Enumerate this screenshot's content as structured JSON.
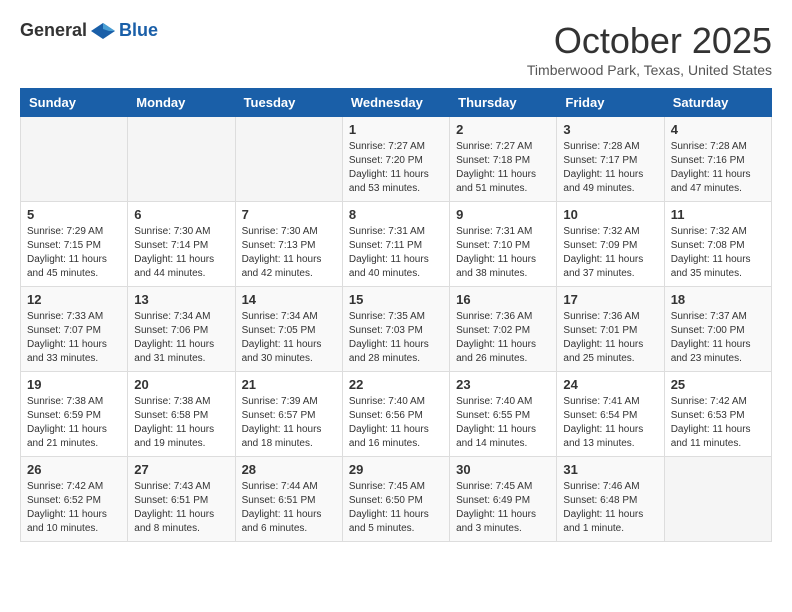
{
  "header": {
    "logo": {
      "general": "General",
      "blue": "Blue"
    },
    "title": "October 2025",
    "location": "Timberwood Park, Texas, United States"
  },
  "weekdays": [
    "Sunday",
    "Monday",
    "Tuesday",
    "Wednesday",
    "Thursday",
    "Friday",
    "Saturday"
  ],
  "weeks": [
    [
      {
        "day": "",
        "info": ""
      },
      {
        "day": "",
        "info": ""
      },
      {
        "day": "",
        "info": ""
      },
      {
        "day": "1",
        "info": "Sunrise: 7:27 AM\nSunset: 7:20 PM\nDaylight: 11 hours and 53 minutes."
      },
      {
        "day": "2",
        "info": "Sunrise: 7:27 AM\nSunset: 7:18 PM\nDaylight: 11 hours and 51 minutes."
      },
      {
        "day": "3",
        "info": "Sunrise: 7:28 AM\nSunset: 7:17 PM\nDaylight: 11 hours and 49 minutes."
      },
      {
        "day": "4",
        "info": "Sunrise: 7:28 AM\nSunset: 7:16 PM\nDaylight: 11 hours and 47 minutes."
      }
    ],
    [
      {
        "day": "5",
        "info": "Sunrise: 7:29 AM\nSunset: 7:15 PM\nDaylight: 11 hours and 45 minutes."
      },
      {
        "day": "6",
        "info": "Sunrise: 7:30 AM\nSunset: 7:14 PM\nDaylight: 11 hours and 44 minutes."
      },
      {
        "day": "7",
        "info": "Sunrise: 7:30 AM\nSunset: 7:13 PM\nDaylight: 11 hours and 42 minutes."
      },
      {
        "day": "8",
        "info": "Sunrise: 7:31 AM\nSunset: 7:11 PM\nDaylight: 11 hours and 40 minutes."
      },
      {
        "day": "9",
        "info": "Sunrise: 7:31 AM\nSunset: 7:10 PM\nDaylight: 11 hours and 38 minutes."
      },
      {
        "day": "10",
        "info": "Sunrise: 7:32 AM\nSunset: 7:09 PM\nDaylight: 11 hours and 37 minutes."
      },
      {
        "day": "11",
        "info": "Sunrise: 7:32 AM\nSunset: 7:08 PM\nDaylight: 11 hours and 35 minutes."
      }
    ],
    [
      {
        "day": "12",
        "info": "Sunrise: 7:33 AM\nSunset: 7:07 PM\nDaylight: 11 hours and 33 minutes."
      },
      {
        "day": "13",
        "info": "Sunrise: 7:34 AM\nSunset: 7:06 PM\nDaylight: 11 hours and 31 minutes."
      },
      {
        "day": "14",
        "info": "Sunrise: 7:34 AM\nSunset: 7:05 PM\nDaylight: 11 hours and 30 minutes."
      },
      {
        "day": "15",
        "info": "Sunrise: 7:35 AM\nSunset: 7:03 PM\nDaylight: 11 hours and 28 minutes."
      },
      {
        "day": "16",
        "info": "Sunrise: 7:36 AM\nSunset: 7:02 PM\nDaylight: 11 hours and 26 minutes."
      },
      {
        "day": "17",
        "info": "Sunrise: 7:36 AM\nSunset: 7:01 PM\nDaylight: 11 hours and 25 minutes."
      },
      {
        "day": "18",
        "info": "Sunrise: 7:37 AM\nSunset: 7:00 PM\nDaylight: 11 hours and 23 minutes."
      }
    ],
    [
      {
        "day": "19",
        "info": "Sunrise: 7:38 AM\nSunset: 6:59 PM\nDaylight: 11 hours and 21 minutes."
      },
      {
        "day": "20",
        "info": "Sunrise: 7:38 AM\nSunset: 6:58 PM\nDaylight: 11 hours and 19 minutes."
      },
      {
        "day": "21",
        "info": "Sunrise: 7:39 AM\nSunset: 6:57 PM\nDaylight: 11 hours and 18 minutes."
      },
      {
        "day": "22",
        "info": "Sunrise: 7:40 AM\nSunset: 6:56 PM\nDaylight: 11 hours and 16 minutes."
      },
      {
        "day": "23",
        "info": "Sunrise: 7:40 AM\nSunset: 6:55 PM\nDaylight: 11 hours and 14 minutes."
      },
      {
        "day": "24",
        "info": "Sunrise: 7:41 AM\nSunset: 6:54 PM\nDaylight: 11 hours and 13 minutes."
      },
      {
        "day": "25",
        "info": "Sunrise: 7:42 AM\nSunset: 6:53 PM\nDaylight: 11 hours and 11 minutes."
      }
    ],
    [
      {
        "day": "26",
        "info": "Sunrise: 7:42 AM\nSunset: 6:52 PM\nDaylight: 11 hours and 10 minutes."
      },
      {
        "day": "27",
        "info": "Sunrise: 7:43 AM\nSunset: 6:51 PM\nDaylight: 11 hours and 8 minutes."
      },
      {
        "day": "28",
        "info": "Sunrise: 7:44 AM\nSunset: 6:51 PM\nDaylight: 11 hours and 6 minutes."
      },
      {
        "day": "29",
        "info": "Sunrise: 7:45 AM\nSunset: 6:50 PM\nDaylight: 11 hours and 5 minutes."
      },
      {
        "day": "30",
        "info": "Sunrise: 7:45 AM\nSunset: 6:49 PM\nDaylight: 11 hours and 3 minutes."
      },
      {
        "day": "31",
        "info": "Sunrise: 7:46 AM\nSunset: 6:48 PM\nDaylight: 11 hours and 1 minute."
      },
      {
        "day": "",
        "info": ""
      }
    ]
  ]
}
